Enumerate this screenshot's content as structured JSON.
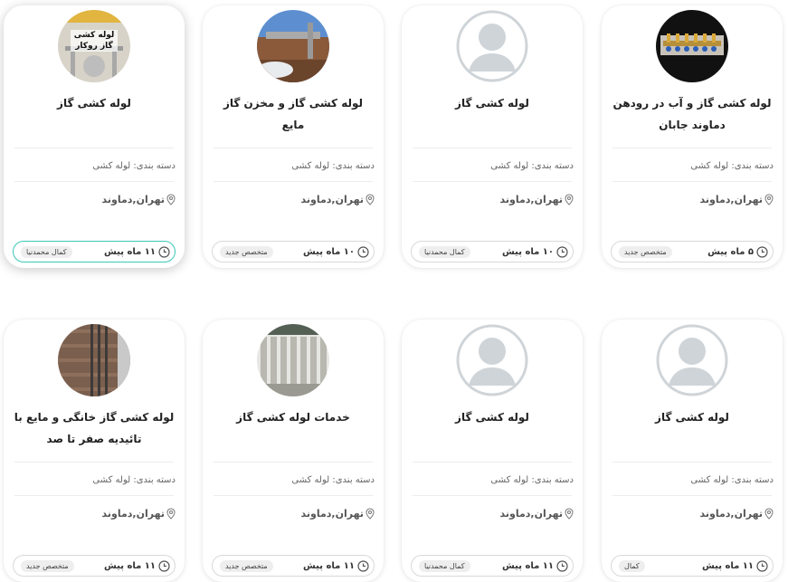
{
  "cards": [
    {
      "title": "لوله کشی گاز و آب در رودهن دماوند جابان",
      "category": "دسته بندی: لوله کشی",
      "location": "تهران,دماوند",
      "time": "۵ ماه پیش",
      "badge": "متخصص جدید",
      "avatar": "photo-pipes-manifold"
    },
    {
      "title": "لوله کشی گاز",
      "category": "دسته بندی: لوله کشی",
      "location": "تهران,دماوند",
      "time": "۱۰ ماه پیش",
      "badge": "کمال محمدنیا",
      "avatar": "default-user"
    },
    {
      "title": "لوله کشی گاز و مخزن گاز مایع",
      "category": "دسته بندی: لوله کشی",
      "location": "تهران,دماوند",
      "time": "۱۰ ماه پیش",
      "badge": "متخصص جدید",
      "avatar": "photo-gas-tank"
    },
    {
      "title": "لوله کشی گاز",
      "category": "دسته بندی: لوله کشی",
      "location": "تهران,دماوند",
      "time": "۱۱ ماه پیش",
      "badge": "کمال محمدنیا",
      "avatar": "photo-text-avatar",
      "avatar_text": "لوله کشی گاز روکار"
    },
    {
      "title": "لوله کشی گاز",
      "category": "دسته بندی: لوله کشی",
      "location": "تهران,دماوند",
      "time": "۱۱ ماه پیش",
      "badge": "کمال",
      "avatar": "default-user"
    },
    {
      "title": "لوله کشی گاز",
      "category": "دسته بندی: لوله کشی",
      "location": "تهران,دماوند",
      "time": "۱۱ ماه پیش",
      "badge": "کمال محمدنیا",
      "avatar": "default-user"
    },
    {
      "title": "خدمات لوله کشی گاز",
      "category": "دسته بندی: لوله کشی",
      "location": "تهران,دماوند",
      "time": "۱۱ ماه پیش",
      "badge": "متخصص جدید",
      "avatar": "photo-wall-pipes"
    },
    {
      "title": "لوله کشی گاز خانگی و مایع با تائیدیه صفر تا صد",
      "category": "دسته بندی: لوله کشی",
      "location": "تهران,دماوند",
      "time": "۱۱ ماه پیش",
      "badge": "متخصص جدید",
      "avatar": "photo-brick-pipes"
    }
  ],
  "colors": {
    "accent": "#3bc7b7",
    "badge_bg": "#eeeeee",
    "avatar_gray": "#cfd4d8"
  }
}
